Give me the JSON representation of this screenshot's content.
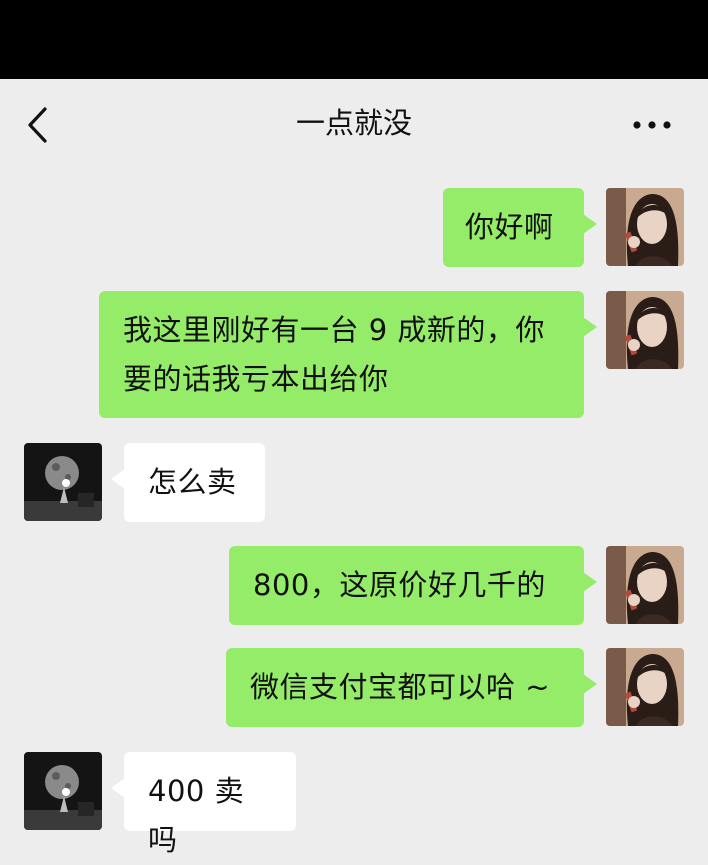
{
  "status_bar": {},
  "header": {
    "title": "一点就没",
    "back_icon": "chevron-left-icon",
    "more_icon": "more-dots-icon"
  },
  "messages": [
    {
      "side": "right",
      "text": "你好啊"
    },
    {
      "side": "right",
      "text": "我这里刚好有一台 9 成新的，你要的话我亏本出给你",
      "lines": [
        "我这里刚好有一台 9 成新的，你",
        "要的话我亏本出给你"
      ]
    },
    {
      "side": "left",
      "text": "怎么卖"
    },
    {
      "side": "right",
      "text": "800，这原价好几千的"
    },
    {
      "side": "right",
      "text": "微信支付宝都可以哈 ~"
    },
    {
      "side": "left",
      "text": "400 卖吗"
    }
  ],
  "colors": {
    "background": "#ededed",
    "sent_bubble": "#95ec69",
    "received_bubble": "#ffffff",
    "status_bar": "#000000"
  }
}
